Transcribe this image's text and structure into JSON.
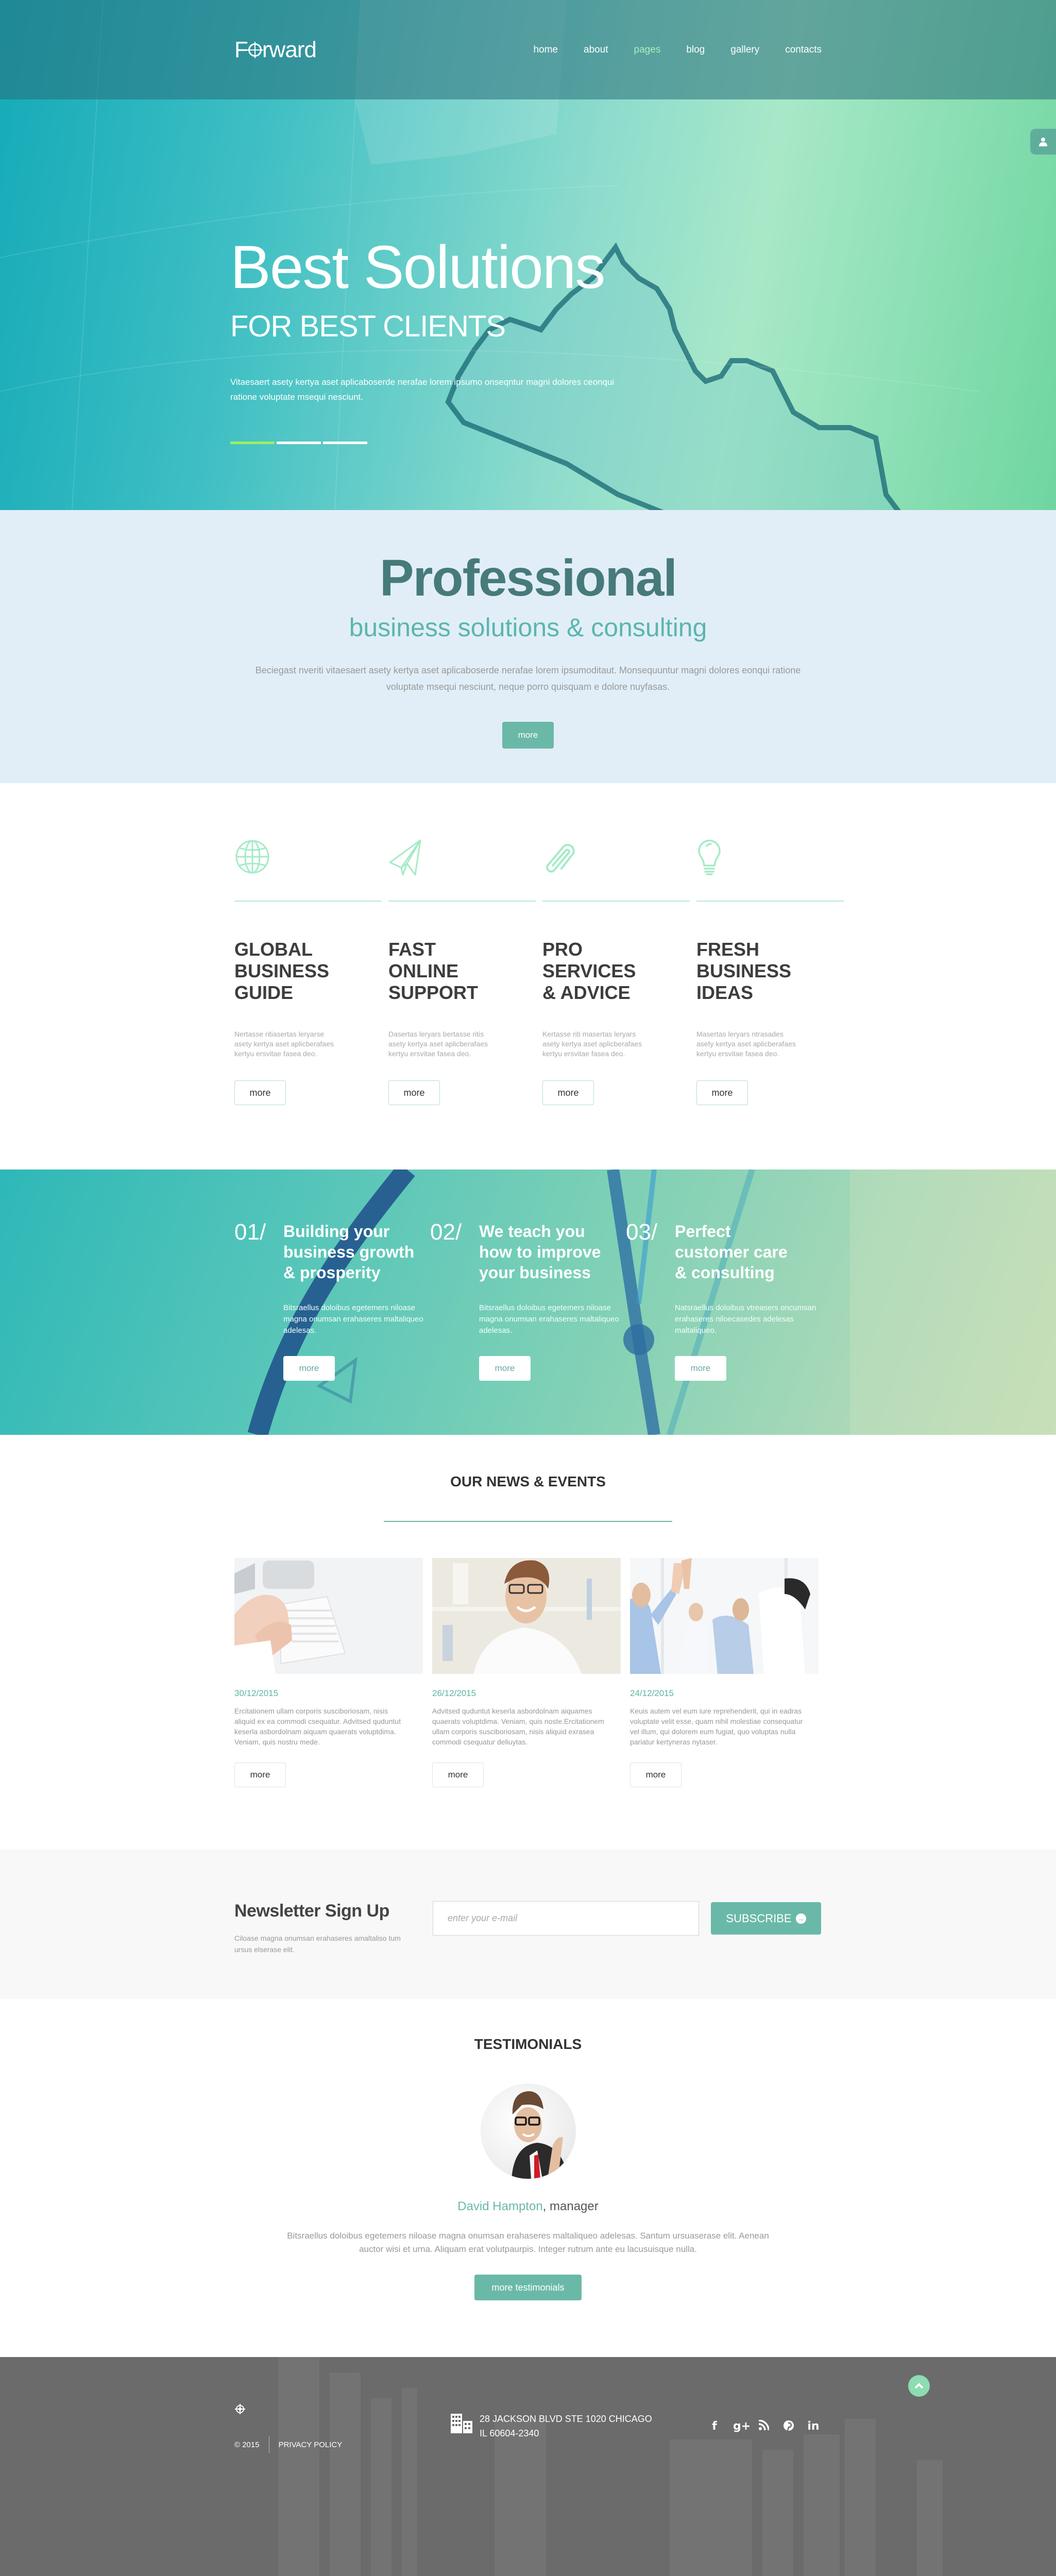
{
  "header": {
    "logo": "Forward",
    "nav": [
      {
        "label": "home",
        "active": false
      },
      {
        "label": "about",
        "active": false
      },
      {
        "label": "pages",
        "active": true
      },
      {
        "label": "blog",
        "active": false
      },
      {
        "label": "gallery",
        "active": false
      },
      {
        "label": "contacts",
        "active": false
      }
    ],
    "side_tab_icon": "user-icon"
  },
  "hero": {
    "title": "Best Solutions",
    "subtitle": "FOR BEST CLIENTS",
    "text": "Vitaesaert asety kertya aset aplicaboserde nerafae lorem ipsumo onseqntur magni dolores ceonqui ratione voluptate msequi nesciunt.",
    "slides": 3,
    "active_slide": 1
  },
  "professional": {
    "title": "Professional",
    "subtitle": "business solutions & consulting",
    "text": "Beciegast nveriti vitaesaert asety kertya aset aplicaboserde nerafae lorem ipsumoditaut. Monsequuntur magni dolores eonqui ratione voluptate msequi nesciunt, neque porro quisquam e dolore nuyfasas.",
    "button": "more"
  },
  "features": [
    {
      "icon": "globe-icon",
      "title": "GLOBAL\nBUSINESS\nGUIDE",
      "text": "Nertasse ritiasertas leryarse asety kertya aset aplicberafaes kertyu ersvitae fasea deo.",
      "button": "more"
    },
    {
      "icon": "paper-plane-icon",
      "title": "FAST\nONLINE\nSUPPORT",
      "text": "Dasertas leryars bertasse ritis asety kertya aset aplicberafaes kertyu ersvitae fasea deo.",
      "button": "more"
    },
    {
      "icon": "paperclip-icon",
      "title": "PRO\nSERVICES\n& ADVICE",
      "text": "Kertasse riti masertas leryars asety kertya aset aplicberafaes kertyu ersvitae fasea deo.",
      "button": "more"
    },
    {
      "icon": "lightbulb-icon",
      "title": "FRESH\nBUSINESS\nIDEAS",
      "text": "Masertas leryars ntrasades asety kertya aset aplicberafaes kertyu ersvitae fasea deo.",
      "button": "more"
    }
  ],
  "steps": [
    {
      "number": "01/",
      "title": "Building your\nbusiness growth\n& prosperity",
      "text": "Bitsraellus doloibus egetemers niloase magna onumsan erahaseres maltaliqueo adelesas.",
      "button": "more"
    },
    {
      "number": "02/",
      "title": "We teach you\nhow to improve\nyour business",
      "text": "Bitsraellus doloibus egetemers niloase magna onumsan erahaseres maltaliqueo adelesas.",
      "button": "more"
    },
    {
      "number": "03/",
      "title": "Perfect\ncustomer care\n& consulting",
      "text": "Natsraellus doloibus vtreasers oncumsan erahaseres niloecasedes adelesas maltaliqueo.",
      "button": "more"
    }
  ],
  "news": {
    "title": "OUR NEWS & EVENTS",
    "items": [
      {
        "image": "hands-typing-keyboard-photo",
        "date": "30/12/2015",
        "text": "Ercitationem ullam corporis susciboriosam, nisis aliquid ex ea commodi csequatur. Advitsed quduntut keserla asbordolnam aiquam quaerats voluptdima. Veniam, quis nostru mede.",
        "button": "more"
      },
      {
        "image": "smiling-man-glasses-photo",
        "date": "26/12/2015",
        "text": "Advitsed quduntut keserla asbordolnam aiquames quaerats voluptdima. Veniam, quis noste.Ercitationem ullam corporis susciboriosam, nisis aliquid exrasea commodi csequatur deliuytas.",
        "button": "more"
      },
      {
        "image": "team-high-five-photo",
        "date": "24/12/2015",
        "text": "Keuis autem vel eum iure reprehenderit, qui in eadras voluptate velit esse, quam nihil molestiae consequatur vel illum, qui dolorem eum fugiat, quo voluptas nulla pariatur kertyneras nytaser.",
        "button": "more"
      }
    ]
  },
  "newsletter": {
    "title": "Newsletter Sign Up",
    "text": "Ciloase magna onumsan erahaseres amaltaliso tum ursus elserase elit.",
    "input_placeholder": "enter your e-mail",
    "input_value": "",
    "button": "SUBSCRIBE"
  },
  "testimonials": {
    "title": "TESTIMONIALS",
    "name": "David Hampton",
    "role": ", manager",
    "text": "Bitsraellus doloibus egetemers niloase magna onumsan erahaseres maltaliqueo adelesas. Santum ursuaserase elit. Aenean auctor wisi et urna. Aliquam erat volutpaurpis. Integer rutrum ante eu lacusuisque nulla.",
    "button": "more testimonials"
  },
  "footer": {
    "copyright": "© 2015",
    "privacy": "PRIVACY POLICY",
    "address_line1": "28 JACKSON BLVD STE 1020 CHICAGO",
    "address_line2": "IL 60604-2340",
    "social": [
      {
        "name": "facebook-icon",
        "glyph": "f"
      },
      {
        "name": "google-plus-icon",
        "glyph": "g+"
      },
      {
        "name": "rss-icon",
        "glyph": "◝"
      },
      {
        "name": "pinterest-icon",
        "glyph": "℗"
      },
      {
        "name": "linkedin-icon",
        "glyph": "in"
      }
    ]
  },
  "colors": {
    "accent": "#6ab9a8",
    "accent_light": "#8ddcb2",
    "active_nav": "#a9f0b8",
    "slider_active": "#9cf05a",
    "heading_dark": "#477a7b",
    "footer_bg": "#6b6b6b"
  }
}
